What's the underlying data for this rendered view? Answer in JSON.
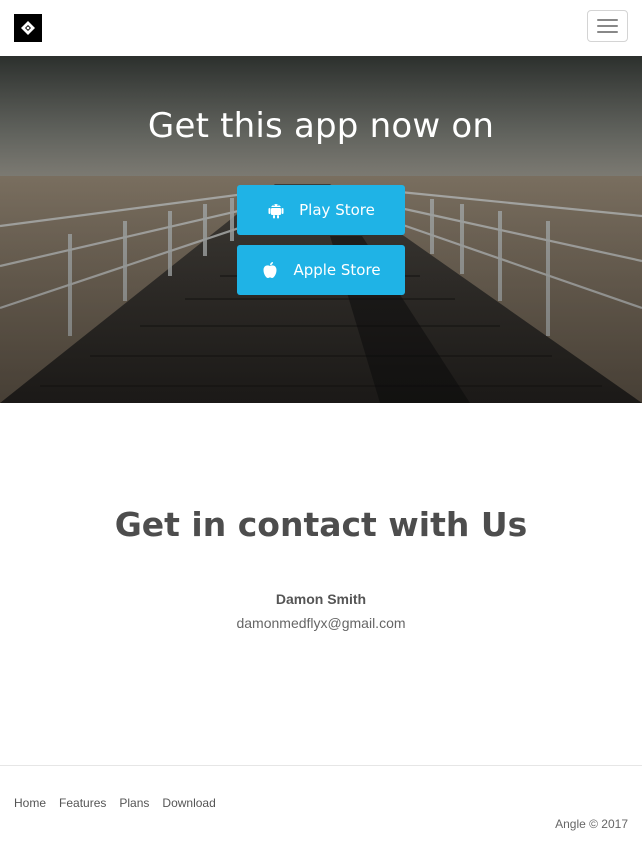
{
  "navbar": {
    "brand_icon": "diamond-logo-icon",
    "menu_icon": "hamburger-menu-icon"
  },
  "hero": {
    "title": "Get this app now on",
    "buttons": [
      {
        "label": "Play Store",
        "icon": "android-icon"
      },
      {
        "label": "Apple Store",
        "icon": "apple-icon"
      }
    ],
    "accent_color": "#1fb3e6"
  },
  "contact": {
    "title": "Get in contact with Us",
    "name": "Damon Smith",
    "email": "damonmedflyx@gmail.com"
  },
  "footer": {
    "links": [
      "Home",
      "Features",
      "Plans",
      "Download"
    ],
    "copyright": "Angle © 2017"
  }
}
